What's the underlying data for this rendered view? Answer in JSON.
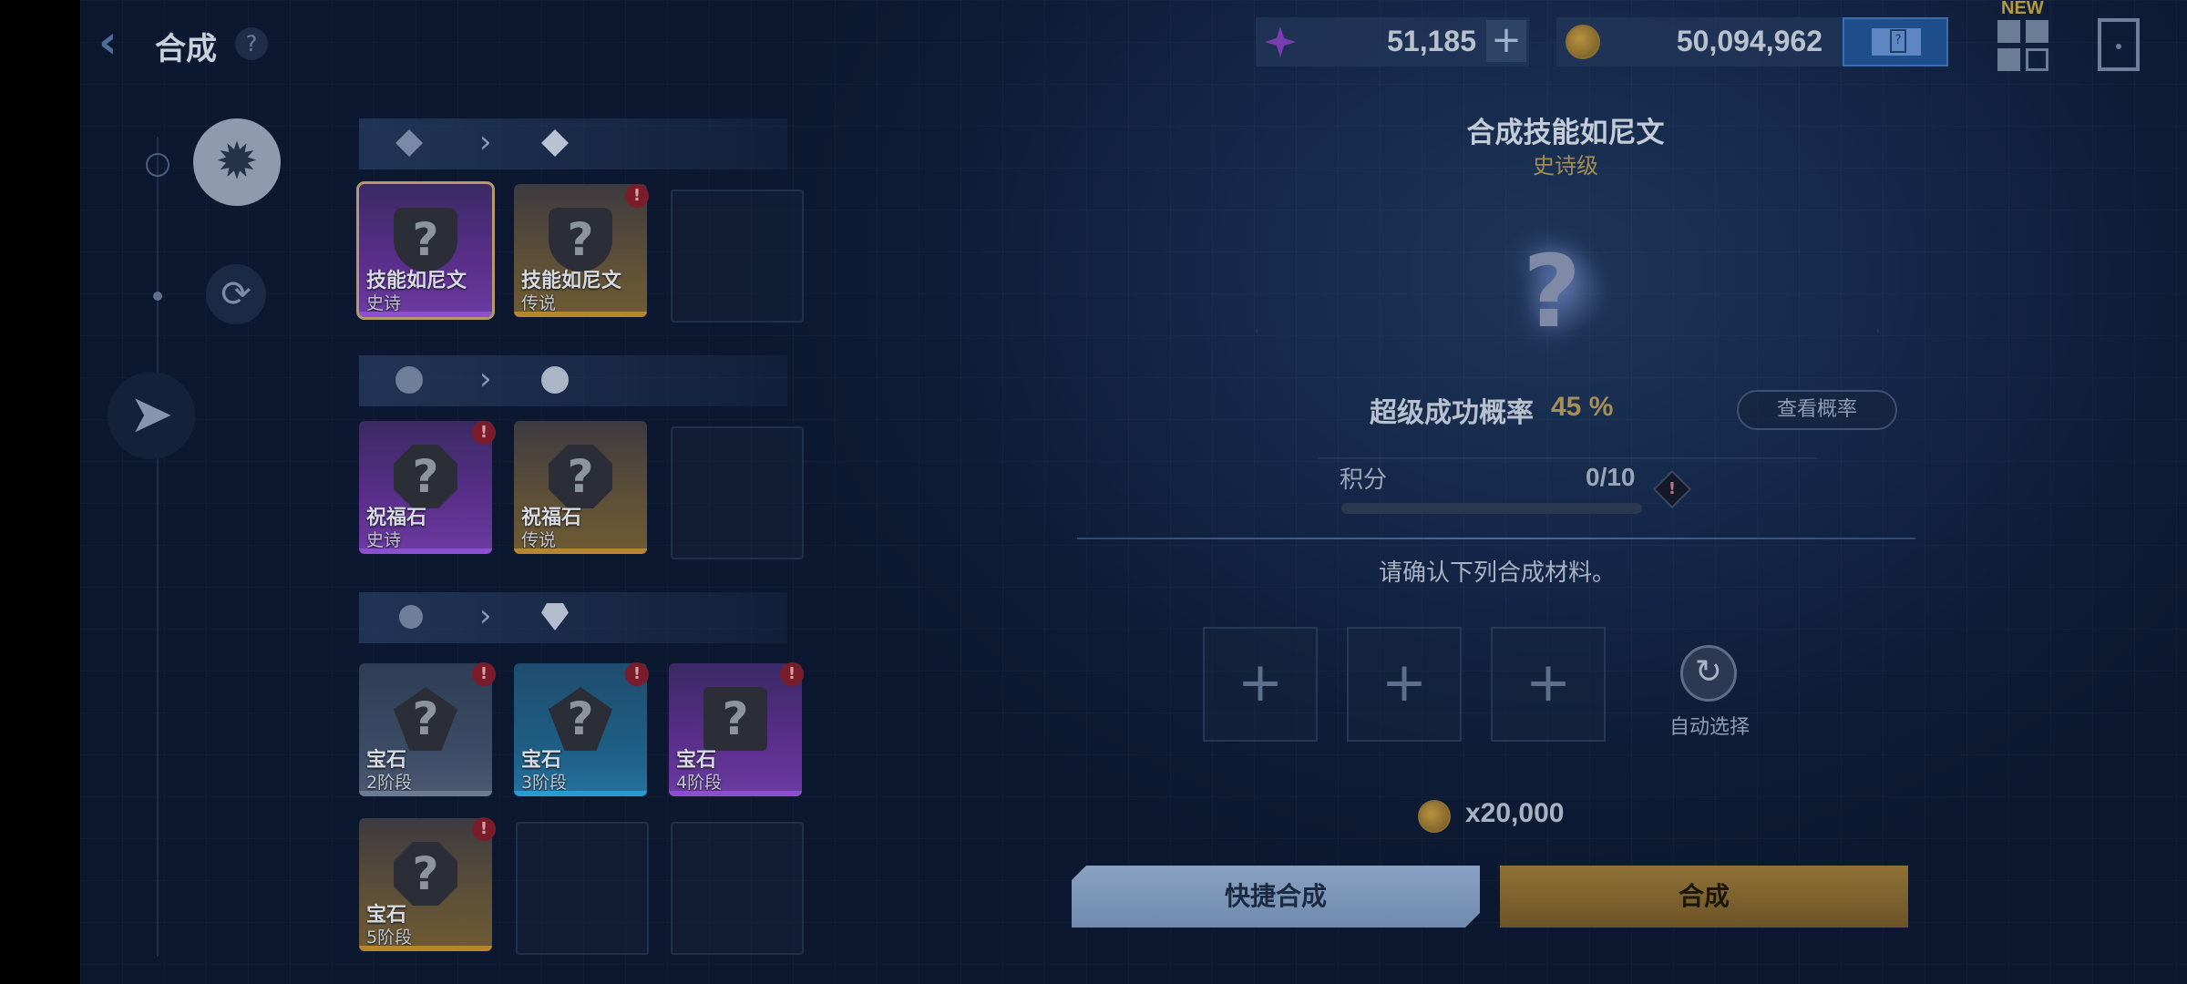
{
  "header": {
    "back_icon": "chevron-left-icon",
    "title": "合成",
    "help": "?",
    "gems": "51,185",
    "gold": "50,094,962",
    "plus": "+",
    "new_tag": "NEW"
  },
  "nav": {
    "items": [
      {
        "name": "synthesis-vortex-icon",
        "selected": true
      },
      {
        "name": "refresh-sparkle-icon",
        "selected": false
      },
      {
        "name": "send-arrow-icon",
        "selected": false
      }
    ]
  },
  "sections": [
    {
      "icons": [
        "rune-shard-icon",
        "rune-shard-upgraded-icon"
      ],
      "items": [
        {
          "name": "技能如尼文",
          "sub": "史诗",
          "rarity": "purple",
          "selected": true,
          "alert": false
        },
        {
          "name": "技能如尼文",
          "sub": "传说",
          "rarity": "gold",
          "selected": false,
          "alert": true
        }
      ]
    },
    {
      "icons": [
        "blessing-stone-icon",
        "blessing-stone-upgraded-icon"
      ],
      "items": [
        {
          "name": "祝福石",
          "sub": "史诗",
          "rarity": "purple",
          "alert": true
        },
        {
          "name": "祝福石",
          "sub": "传说",
          "rarity": "gold",
          "alert": false
        }
      ]
    },
    {
      "icons": [
        "gem-raw-icon",
        "gem-cut-icon"
      ],
      "items": [
        {
          "name": "宝石",
          "sub": "2阶段",
          "rarity": "grey",
          "alert": true
        },
        {
          "name": "宝石",
          "sub": "3阶段",
          "rarity": "blue",
          "alert": true
        },
        {
          "name": "宝石",
          "sub": "4阶段",
          "rarity": "purple",
          "alert": true
        },
        {
          "name": "宝石",
          "sub": "5阶段",
          "rarity": "gold",
          "alert": true
        }
      ]
    }
  ],
  "panel": {
    "title": "合成技能如尼文",
    "grade": "史诗级",
    "big_q": "?",
    "rate_label": "超级成功概率",
    "rate_value": "45 %",
    "view_rate": "查看概率",
    "points_label": "积分",
    "points_value": "0/10",
    "points_progress": 0,
    "info": "!",
    "confirm": "请确认下列合成材料。",
    "mat_plus": "+",
    "auto_select": "自动选择",
    "cost": "x20,000",
    "quick_btn": "快捷合成",
    "make_btn": "合成"
  },
  "colors": {
    "accent_gold": "#a88f55",
    "epic_purple": "#8b4fd0",
    "legend_gold": "#b8862e",
    "alert_red": "#7a1d2a"
  }
}
